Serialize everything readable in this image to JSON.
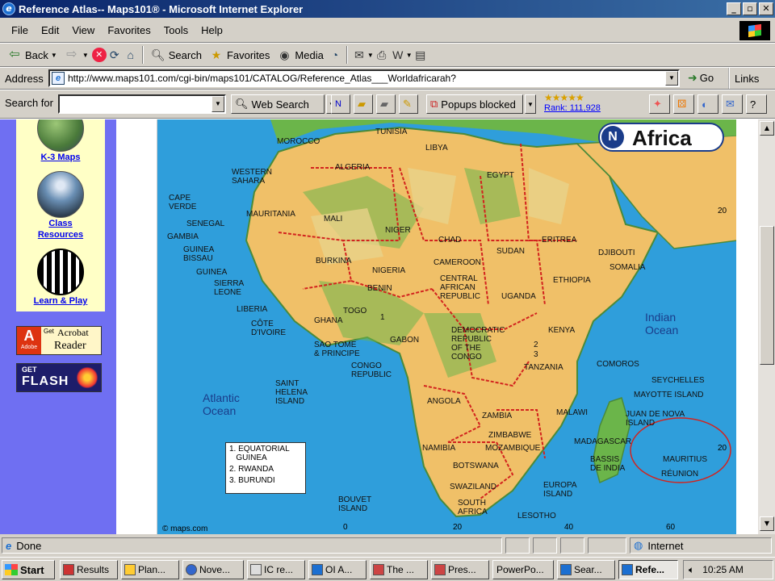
{
  "window": {
    "title": "Reference Atlas-- Maps101® - Microsoft Internet Explorer",
    "min": "_",
    "max": "▫",
    "close": "✕"
  },
  "menu": [
    "File",
    "Edit",
    "View",
    "Favorites",
    "Tools",
    "Help"
  ],
  "toolbar": {
    "back": "Back",
    "search": "Search",
    "favorites": "Favorites",
    "media": "Media"
  },
  "address": {
    "label": "Address",
    "url": "http://www.maps101.com/cgi-bin/maps101/CATALOG/Reference_Atlas___Worldafricarah?",
    "go": "Go",
    "links": "Links"
  },
  "searchbar": {
    "label": "Search for",
    "web_search": "Web Search",
    "popups": "Popups blocked",
    "rank": "Rank: 111,928"
  },
  "sidebar": {
    "items": [
      {
        "label": "K-3 Maps"
      },
      {
        "label": "Class\nResources"
      },
      {
        "label": "Learn & Play"
      }
    ],
    "acrobat": {
      "top": "Get",
      "brand": "Acrobat",
      "name": "Reader",
      "maker": "Adobe"
    },
    "flash": {
      "top": "GET",
      "name": "FLASH"
    }
  },
  "map": {
    "title": "Africa",
    "compass": "N",
    "credit": "© maps.com",
    "oceans": [
      {
        "name": "Atlantic\nOcean"
      },
      {
        "name": "Indian\nOcean"
      }
    ],
    "labels": [
      "TUNISIA",
      "MOROCCO",
      "ALGERIA",
      "LIBYA",
      "EGYPT",
      "WESTERN\nSAHARA",
      "CAPE\nVERDE",
      "MAURITANIA",
      "MALI",
      "NIGER",
      "CHAD",
      "SUDAN",
      "ERITREA",
      "DJIBOUTI",
      "SENEGAL",
      "GAMBIA",
      "GUINEA\nBISSAU",
      "GUINEA",
      "SIERRA\nLEONE",
      "LIBERIA",
      "CÔTE\nD'IVOIRE",
      "GHANA",
      "TOGO",
      "BENIN",
      "BURKINA",
      "NIGERIA",
      "CAMEROON",
      "CENTRAL\nAFRICAN\nREPUBLIC",
      "ETHIOPIA",
      "SOMALIA",
      "UGANDA",
      "KENYA",
      "SAO TOME\n& PRINCIPE",
      "GABON",
      "CONGO\nREPUBLIC",
      "DEMOCRATIC\nREPUBLIC\nOF THE\nCONGO",
      "TANZANIA",
      "COMOROS",
      "SEYCHELLES",
      "MAYOTTE ISLAND",
      "SAINT\nHELENA\nISLAND",
      "ANGOLA",
      "ZAMBIA",
      "MALAWI",
      "JUAN DE NOVA\nISLAND",
      "ZIMBABWE",
      "MOZAMBIQUE",
      "NAMIBIA",
      "BOTSWANA",
      "MADAGASCAR",
      "BASSIS\nDE INDIA",
      "MAURITIUS",
      "RÉUNION",
      "SWAZILAND",
      "EUROPA\nISLAND",
      "SOUTH\nAFRICA",
      "LESOTHO",
      "BOUVET\nISLAND"
    ],
    "markers": [
      "1",
      "2",
      "3"
    ],
    "legend": [
      "1. EQUATORIAL\n   GUINEA",
      "2. RWANDA",
      "3. BURUNDI"
    ],
    "ticks": [
      "20",
      "20",
      "0",
      "20",
      "40",
      "60"
    ]
  },
  "status": {
    "text": "Done",
    "zone": "Internet"
  },
  "taskbar": {
    "start": "Start",
    "tasks": [
      "Results",
      "Plan...",
      "Nove...",
      "IC re...",
      "OI A...",
      "The ...",
      "Pres...",
      "PowerPo...",
      "Sear...",
      "Refe..."
    ],
    "clock": "10:25 AM"
  },
  "colors": {
    "title_bar": "#0a246a",
    "sidebar_blue": "#6f6ff2",
    "sidebar_yellow": "#ffffc6",
    "ocean": "#2f9edb",
    "land_green": "#6bb54a",
    "land_tan": "#f0c068",
    "border_red": "#d2231e"
  }
}
